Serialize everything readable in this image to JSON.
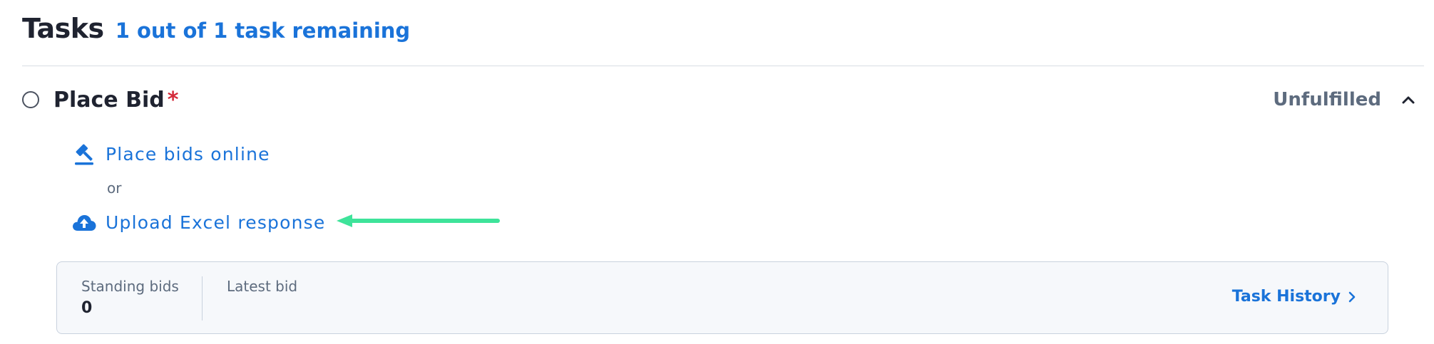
{
  "header": {
    "title": "Tasks",
    "remaining": "1 out of 1 task remaining"
  },
  "task": {
    "name": "Place Bid",
    "required_marker": "*",
    "status": "Unfulfilled",
    "collapse_icon": "chevron-up-icon"
  },
  "actions": {
    "online_label": "Place bids online",
    "online_icon": "gavel-icon",
    "separator": "or",
    "upload_label": "Upload Excel response",
    "upload_icon": "cloud-upload-icon"
  },
  "bid_panel": {
    "standing_bids_label": "Standing bids",
    "standing_bids_value": "0",
    "latest_bid_label": "Latest bid",
    "latest_bid_value": "",
    "history_label": "Task History",
    "history_icon": "chevron-right-icon"
  },
  "colors": {
    "accent": "#1a73d9",
    "required": "#d42a3a",
    "status": "#5d6b7e",
    "annotation_arrow": "#3ee39a"
  }
}
